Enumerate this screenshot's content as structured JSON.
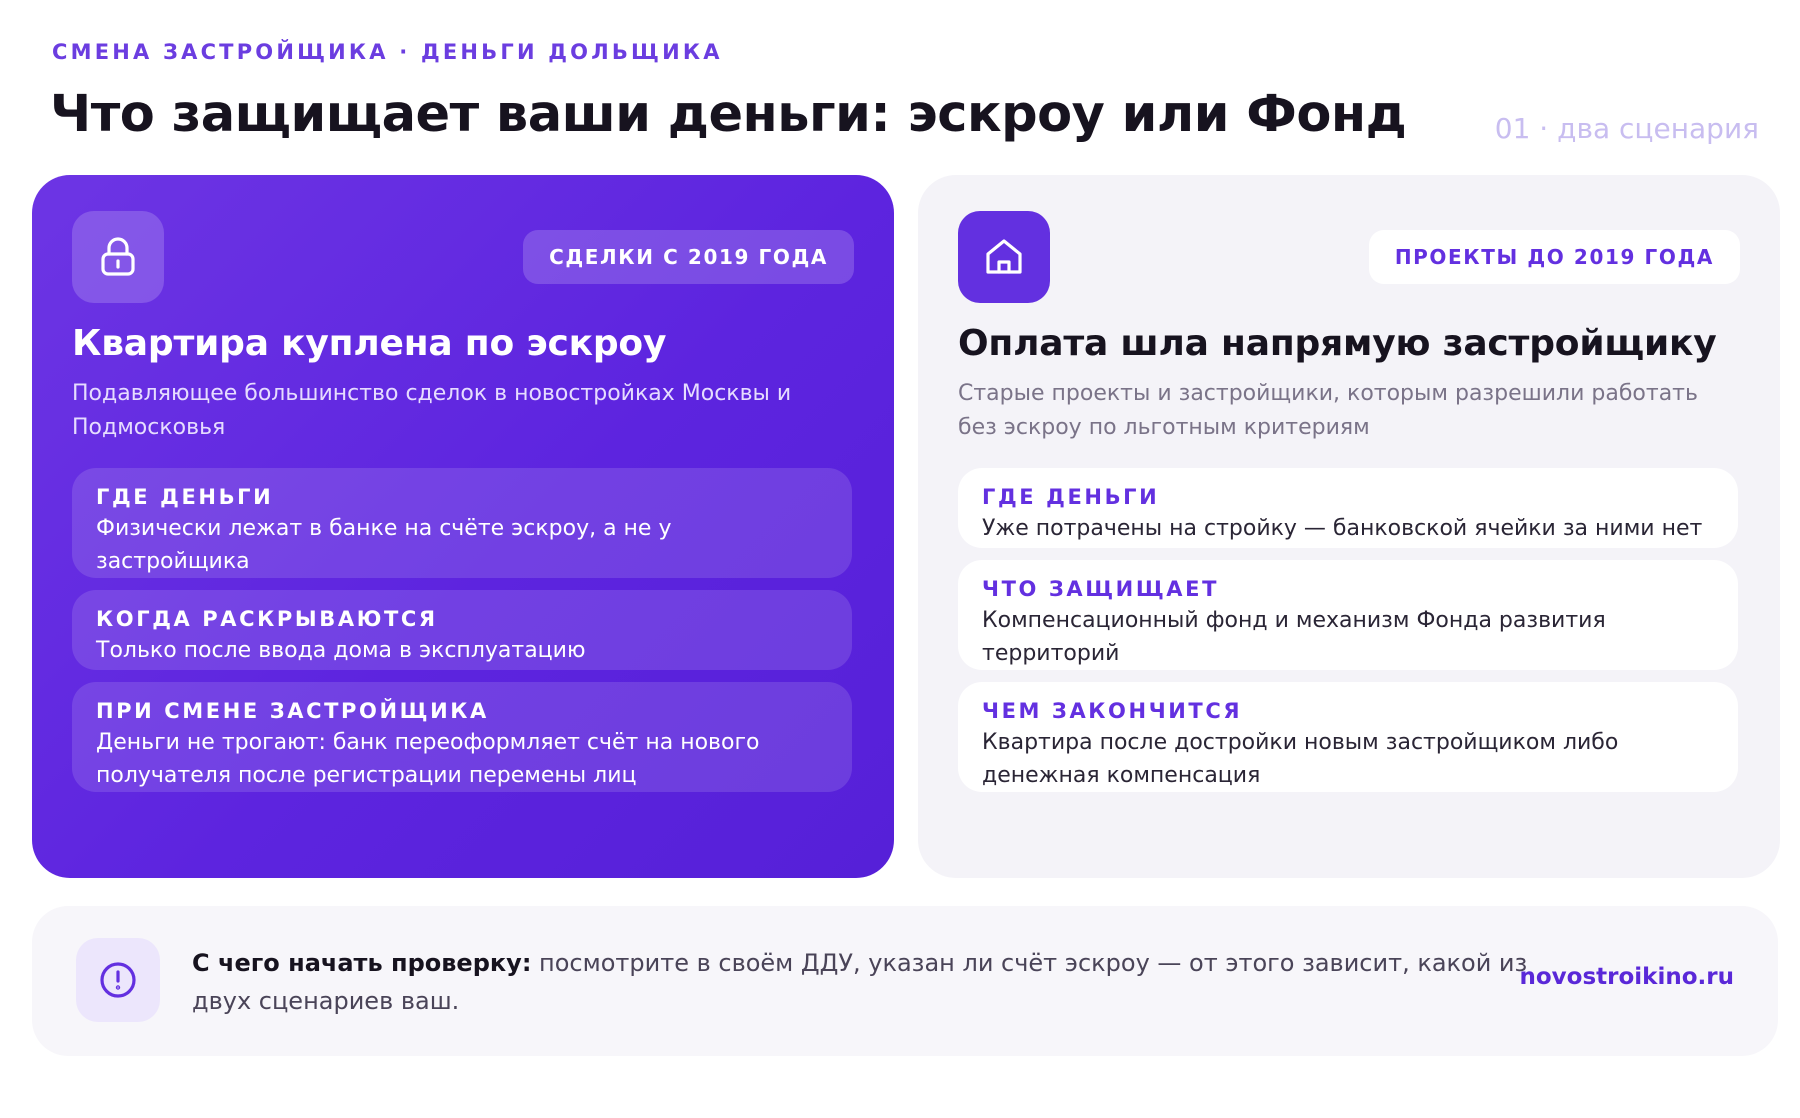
{
  "header": {
    "eyebrow": "СМЕНА ЗАСТРОЙЩИКА · ДЕНЬГИ ДОЛЬЩИКА",
    "title": "Что защищает ваши деньги: эскроу или Фонд",
    "scenario": "01 · два сценария"
  },
  "left_card": {
    "icon": "lock-icon",
    "badge": "СДЕЛКИ С 2019 ГОДА",
    "title": "Квартира куплена по эскроу",
    "description": "Подавляющее большинство сделок в новостройках Москвы и Подмосковья",
    "items": [
      {
        "label": "ГДЕ ДЕНЬГИ",
        "text": "Физически лежат в банке на счёте эскроу, а не у застройщика"
      },
      {
        "label": "КОГДА РАСКРЫВАЮТСЯ",
        "text": "Только после ввода дома в эксплуатацию"
      },
      {
        "label": "ПРИ СМЕНЕ ЗАСТРОЙЩИКА",
        "text": "Деньги не трогают: банк переоформляет счёт на нового получателя после регистрации перемены лиц"
      }
    ]
  },
  "right_card": {
    "icon": "house-icon",
    "badge": "ПРОЕКТЫ ДО 2019 ГОДА",
    "title": "Оплата шла напрямую застройщику",
    "description": "Старые проекты и застройщики, которым разрешили работать без эскроу по льготным критериям",
    "items": [
      {
        "label": "ГДЕ ДЕНЬГИ",
        "text": "Уже потрачены на стройку — банковской ячейки за ними нет"
      },
      {
        "label": "ЧТО ЗАЩИЩАЕТ",
        "text": "Компенсационный фонд и механизм Фонда развития территорий"
      },
      {
        "label": "ЧЕМ ЗАКОНЧИТСЯ",
        "text": "Квартира после достройки новым застройщиком либо денежная компенсация"
      }
    ]
  },
  "footer": {
    "icon": "alert-circle-icon",
    "lead": "С чего начать проверку:",
    "text": " посмотрите в своём ДДУ, указан ли счёт эскроу — от этого зависит, какой из двух сценариев ваш.",
    "site": "novostroikino.ru"
  },
  "colors": {
    "accent": "#6330e0",
    "left_card_bg": "#6d35e4",
    "right_card_bg": "#f4f3f8",
    "footer_bg": "#f7f6fa"
  }
}
